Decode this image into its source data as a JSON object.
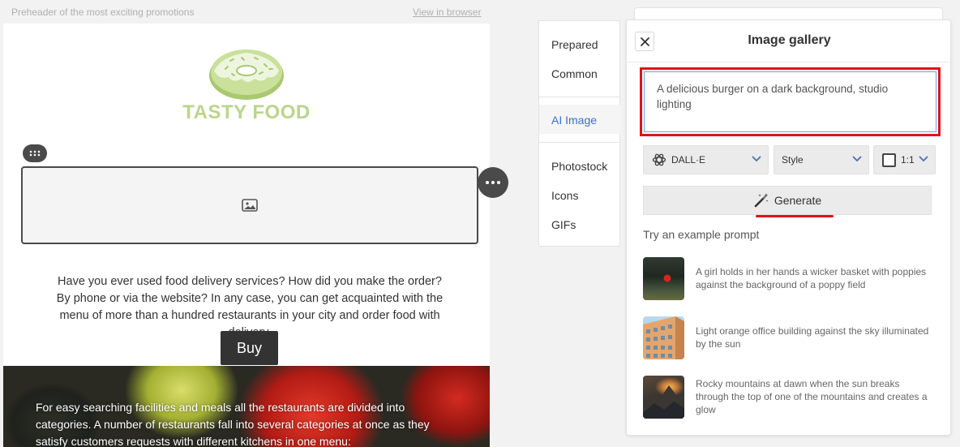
{
  "email": {
    "preheader": "Preheader of the most exciting promotions",
    "view_in_browser": "View in browser",
    "logo_text": "TASTY FOOD",
    "body_text": "Have you ever used food delivery services? How did you make the order? By phone or via the website? In any case, you can get acquainted with the menu of more than a hundred restaurants in your city and order food with delivery.",
    "buy_label": "Buy",
    "banner_text": "For easy searching facilities and meals all the restaurants are divided into categories. A number of restaurants fall into several categories at once as they satisfy customers requests with different kitchens in one menu:"
  },
  "sidenav": {
    "items": [
      {
        "label": "Prepared"
      },
      {
        "label": "Common"
      },
      {
        "label": "AI Image",
        "active": true
      },
      {
        "label": "Photostock"
      },
      {
        "label": "Icons"
      },
      {
        "label": "GIFs"
      }
    ]
  },
  "gallery": {
    "title": "Image gallery",
    "prompt_value": "A delicious burger on a dark background, studio lighting",
    "model_select": "DALL·E",
    "style_select": "Style",
    "ratio_select": "1:1",
    "generate_label": "Generate",
    "try_label": "Try an example prompt",
    "examples": [
      {
        "text": "A girl holds in her hands a wicker basket with poppies against the background of a poppy field"
      },
      {
        "text": "Light orange office building against the sky illuminated by the sun"
      },
      {
        "text": "Rocky mountains at dawn when the sun breaks through the top of one of the mountains and creates a glow"
      }
    ]
  },
  "colors": {
    "accent_active": "#3d6fd1",
    "highlight_red": "#e0121b",
    "logo_green": "#b9d68a",
    "dark_button": "#333333"
  }
}
